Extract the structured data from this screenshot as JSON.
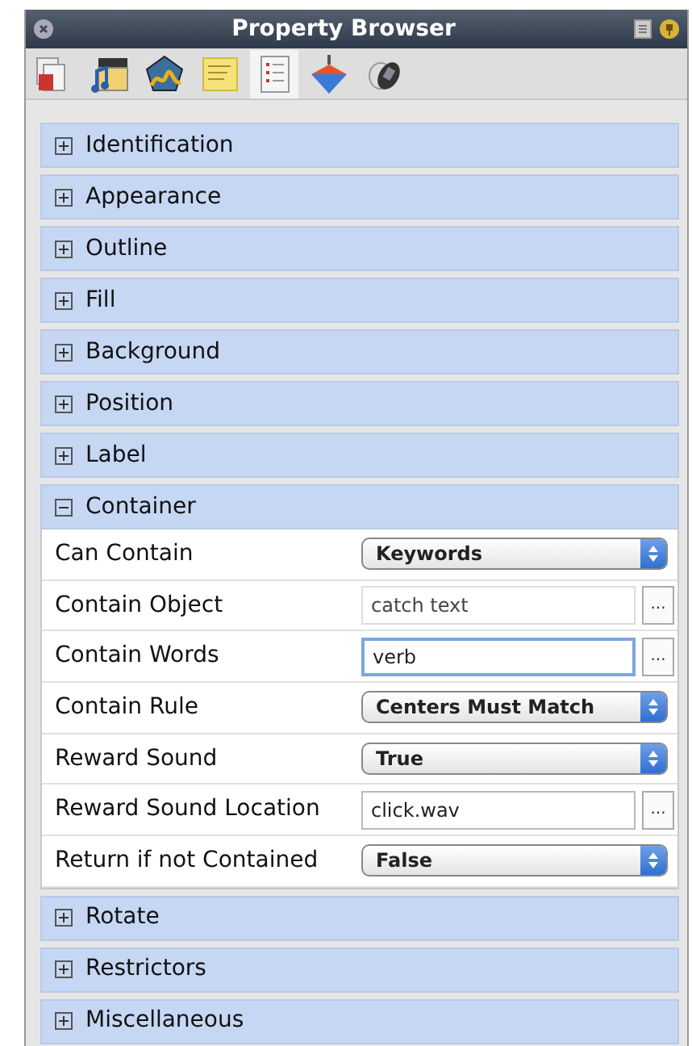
{
  "window": {
    "title": "Property Browser"
  },
  "toolbar": [
    {
      "selected": false
    },
    {
      "selected": false
    },
    {
      "selected": false
    },
    {
      "selected": false
    },
    {
      "selected": true
    },
    {
      "selected": false
    },
    {
      "selected": false
    }
  ],
  "sections": [
    {
      "label": "Identification",
      "expanded": false
    },
    {
      "label": "Appearance",
      "expanded": false
    },
    {
      "label": "Outline",
      "expanded": false
    },
    {
      "label": "Fill",
      "expanded": false
    },
    {
      "label": "Background",
      "expanded": false
    },
    {
      "label": "Position",
      "expanded": false
    },
    {
      "label": "Label",
      "expanded": false
    },
    {
      "label": "Container",
      "expanded": true,
      "rows": [
        {
          "label": "Can Contain",
          "kind": "select",
          "value": "Keywords"
        },
        {
          "label": "Contain Object",
          "kind": "text",
          "value": "catch text",
          "focused": false,
          "disabled": true,
          "button": "..."
        },
        {
          "label": "Contain Words",
          "kind": "text",
          "value": "verb",
          "focused": true,
          "disabled": false,
          "button": "..."
        },
        {
          "label": "Contain Rule",
          "kind": "select",
          "value": "Centers Must Match"
        },
        {
          "label": "Reward Sound",
          "kind": "select",
          "value": "True"
        },
        {
          "label": "Reward Sound Location",
          "kind": "text",
          "value": "click.wav",
          "focused": false,
          "disabled": false,
          "button": "..."
        },
        {
          "label": "Return if not Contained",
          "kind": "select",
          "value": "False"
        }
      ]
    },
    {
      "label": "Rotate",
      "expanded": false
    },
    {
      "label": "Restrictors",
      "expanded": false
    },
    {
      "label": "Miscellaneous",
      "expanded": false
    }
  ]
}
